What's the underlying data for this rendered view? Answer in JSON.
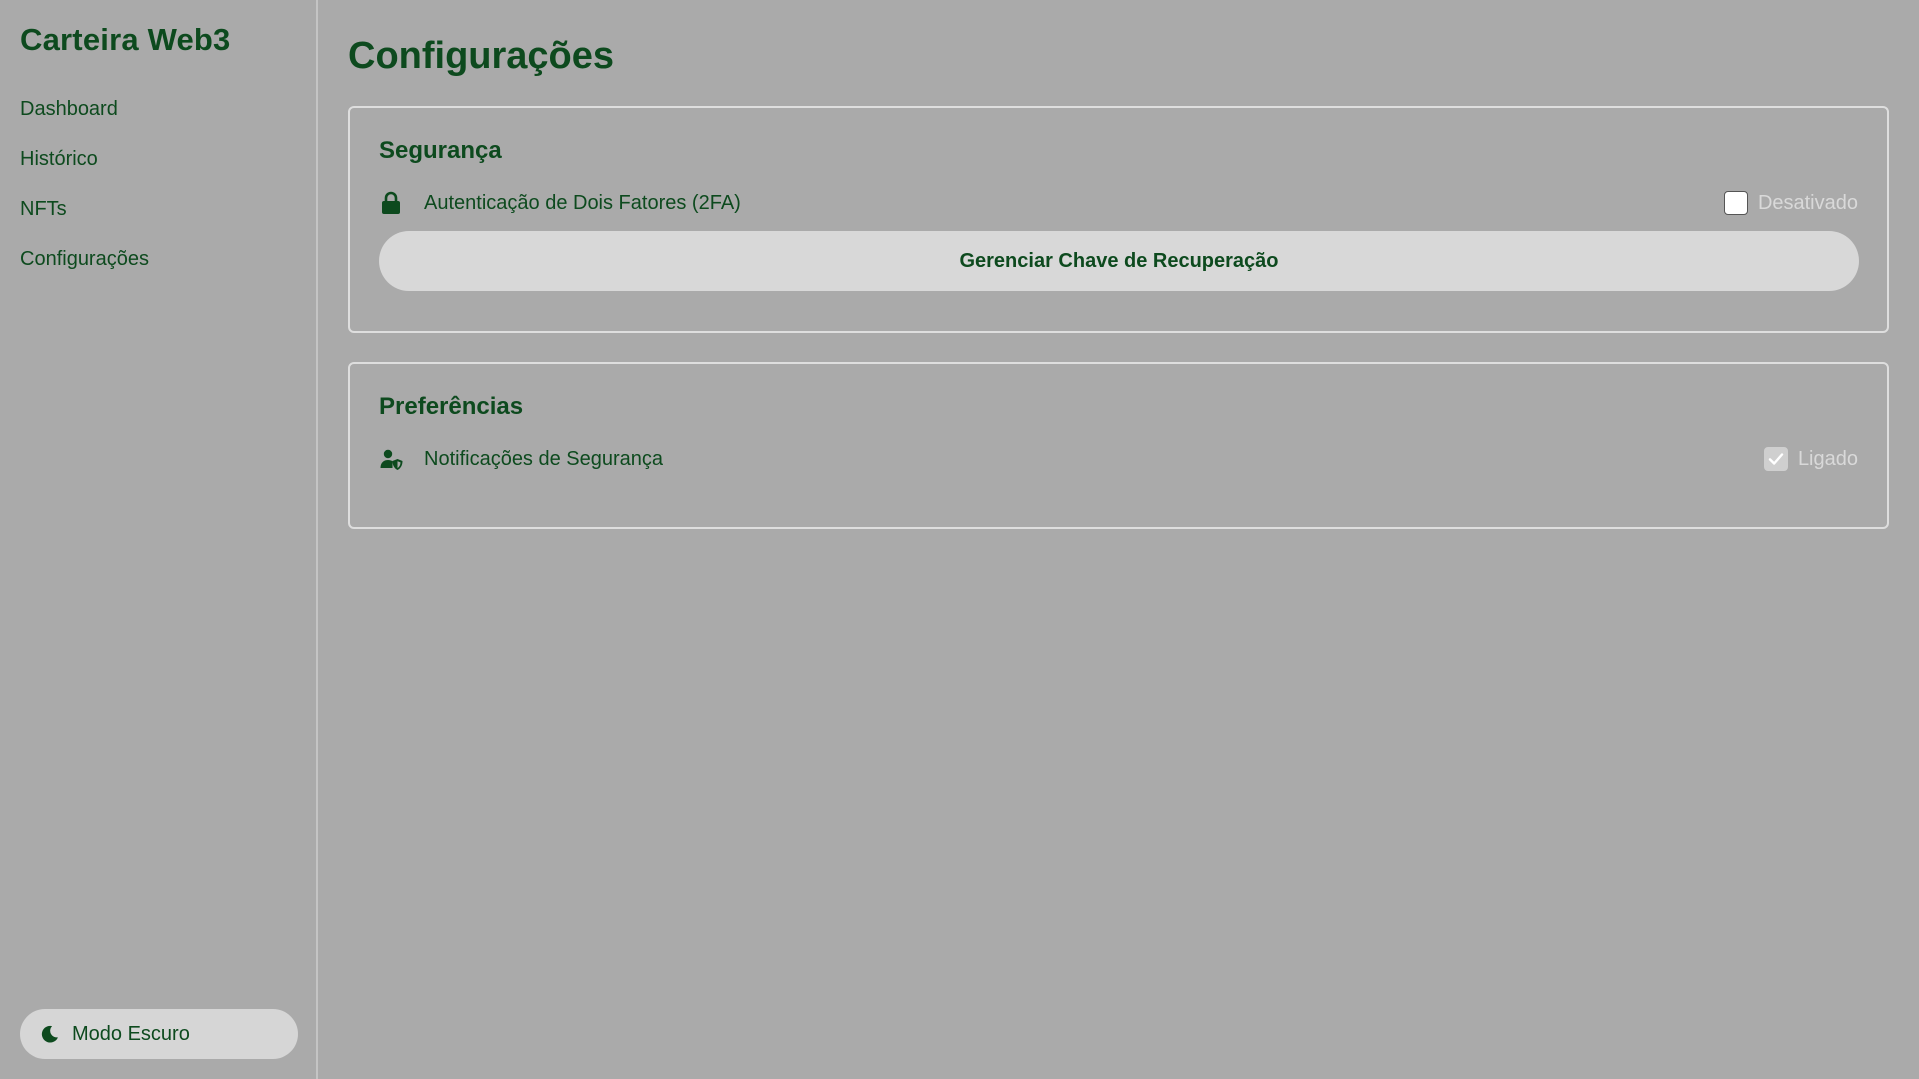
{
  "sidebar": {
    "brand": "Carteira Web3",
    "items": [
      {
        "label": "Dashboard"
      },
      {
        "label": "Histórico"
      },
      {
        "label": "NFTs"
      },
      {
        "label": "Configurações"
      }
    ],
    "theme_toggle": {
      "label": "Modo Escuro",
      "icon": "moon-icon"
    }
  },
  "main": {
    "title": "Configurações",
    "security": {
      "title": "Segurança",
      "twofa": {
        "label": "Autenticação de Dois Fatores (2FA)",
        "icon": "lock-icon",
        "checked": false,
        "status": "Desativado"
      },
      "recovery_button": "Gerenciar Chave de Recuperação"
    },
    "preferences": {
      "title": "Preferências",
      "notifications": {
        "label": "Notificações de Segurança",
        "icon": "user-shield-icon",
        "checked": true,
        "status": "Ligado"
      }
    }
  },
  "colors": {
    "background": "#aaaaaa",
    "text": "#0d4a1e",
    "button": "#d8d8d8",
    "status": "#d9d9d9"
  }
}
